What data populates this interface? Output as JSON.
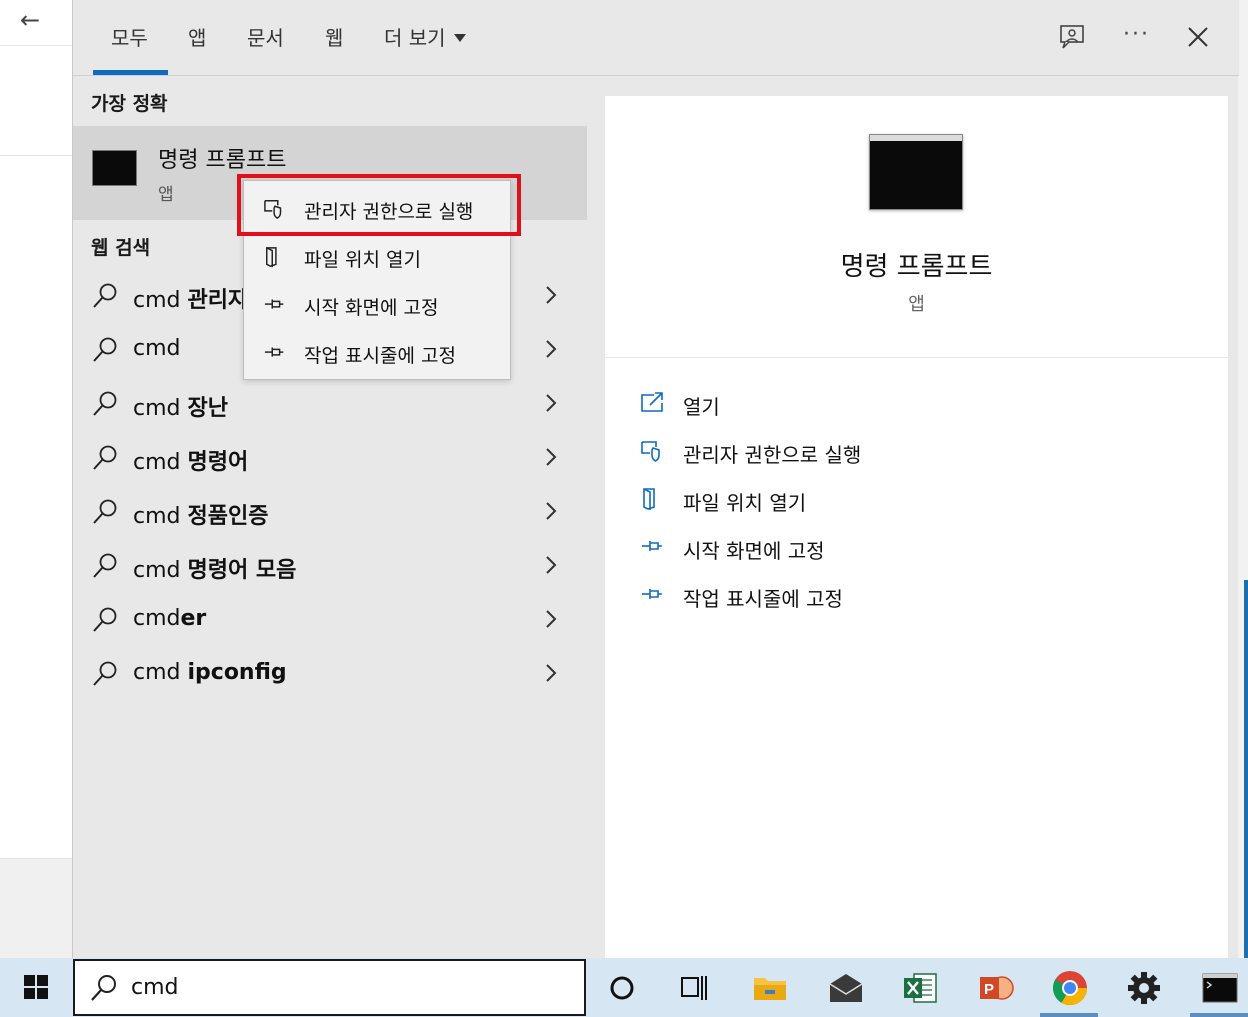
{
  "tabs": [
    {
      "label": "모두",
      "selected": true
    },
    {
      "label": "앱"
    },
    {
      "label": "문서"
    },
    {
      "label": "웹"
    },
    {
      "label": "더 보기"
    }
  ],
  "top_icons": [
    "feedback-icon",
    "more-icon",
    "close-icon"
  ],
  "best_match": {
    "heading": "가장 정확",
    "title": "명령 프롬프트",
    "subtitle": "앱"
  },
  "web": {
    "heading": "웹 검색",
    "items": [
      {
        "prefix": "cmd ",
        "bold": "관리자"
      },
      {
        "prefix": "cmd",
        "bold": ""
      },
      {
        "prefix": "cmd ",
        "bold": "장난"
      },
      {
        "prefix": "cmd ",
        "bold": "명령어"
      },
      {
        "prefix": "cmd ",
        "bold": "정품인증"
      },
      {
        "prefix": "cmd ",
        "bold": "명령어 모음"
      },
      {
        "prefix": "cmd",
        "bold": "er"
      },
      {
        "prefix": "cmd ",
        "bold": "ipconfig"
      }
    ]
  },
  "context_menu": {
    "items": [
      {
        "label": "관리자 권한으로 실행",
        "icon": "shield-icon",
        "highlighted": true
      },
      {
        "label": "파일 위치 열기",
        "icon": "folder-icon"
      },
      {
        "label": "시작 화면에 고정",
        "icon": "pin-icon"
      },
      {
        "label": "작업 표시줄에 고정",
        "icon": "pin-icon"
      }
    ]
  },
  "detail": {
    "title": "명령 프롬프트",
    "subtitle": "앱",
    "actions": [
      {
        "label": "열기",
        "icon": "open-icon"
      },
      {
        "label": "관리자 권한으로 실행",
        "icon": "shield-icon"
      },
      {
        "label": "파일 위치 열기",
        "icon": "folder-icon"
      },
      {
        "label": "시작 화면에 고정",
        "icon": "pin-icon"
      },
      {
        "label": "작업 표시줄에 고정",
        "icon": "pin-icon"
      }
    ]
  },
  "search": {
    "value": "cmd"
  },
  "taskbar": {
    "icons": [
      "cortana-icon",
      "task-view-icon",
      "file-explorer-icon",
      "mail-icon",
      "excel-icon",
      "powerpoint-icon",
      "chrome-icon",
      "settings-icon",
      "command-prompt-icon"
    ]
  },
  "colors": {
    "accent": "#0f6cbd",
    "highlight_box": "#e0101b"
  }
}
